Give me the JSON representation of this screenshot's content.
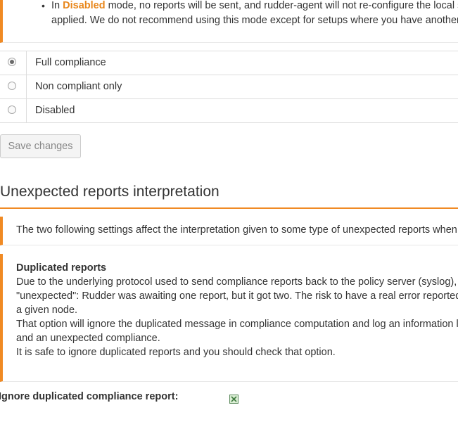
{
  "top_callout": {
    "bullet": "•",
    "line1_prefix": "In ",
    "line1_highlight": "Disabled",
    "line1_suffix": " mode, no reports will be sent, and rudder-agent will not re-configure the local sy",
    "line2": "applied. We do not recommend using this mode except for setups where you have another f"
  },
  "compliance_modes": {
    "options": [
      {
        "label": "Full compliance",
        "selected": true
      },
      {
        "label": "Non compliant only",
        "selected": false
      },
      {
        "label": "Disabled",
        "selected": false
      }
    ],
    "save_label": "Save changes"
  },
  "unexpected_section": {
    "title": "Unexpected reports interpretation",
    "info": "The two following settings affect the interpretation given to some type of unexpected reports when co",
    "duplicated": {
      "title": "Duplicated reports",
      "lines": [
        "Due to the underlying protocol used to send compliance reports back to the policy server (syslog), it",
        "\"unexpected\": Rudder was awaiting one report, but it got two. The risk to have a real error reported a",
        "a given node.",
        "That option will ignore the duplicated message in compliance computation and log an information lev",
        "and an unexpected compliance.",
        "It is safe to ignore duplicated reports and you should check that option."
      ]
    },
    "ignore_duplicated": {
      "label": "Ignore duplicated compliance report:",
      "checked": true
    }
  },
  "colors": {
    "accent": "#f08a24",
    "highlight": "#e8861a"
  }
}
